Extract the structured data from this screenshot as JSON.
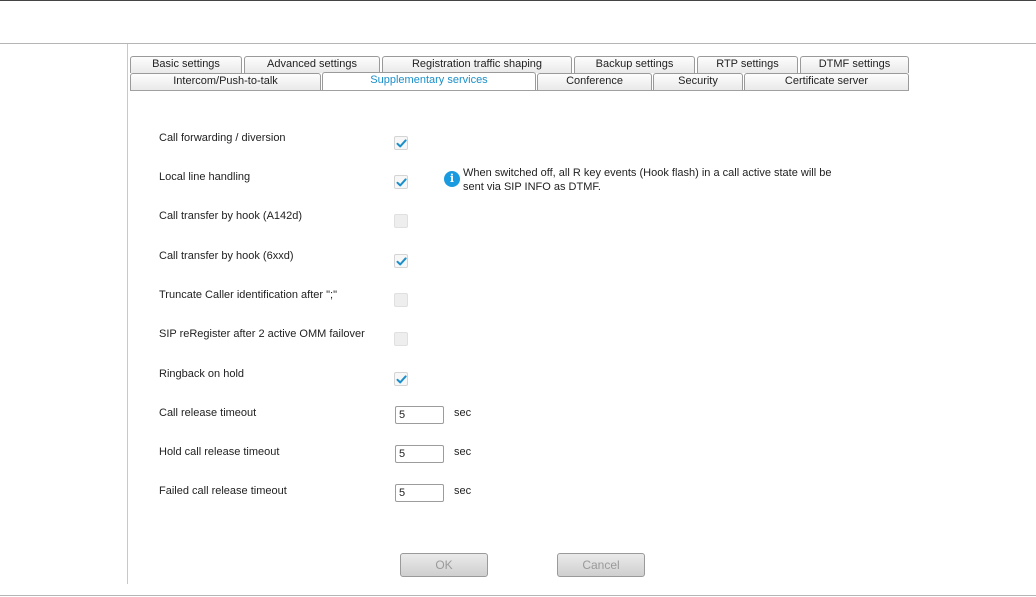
{
  "tabs_row1": [
    "Basic settings",
    "Advanced settings",
    "Registration traffic shaping",
    "Backup settings",
    "RTP settings",
    "DTMF settings"
  ],
  "tabs_row2": [
    "Intercom/Push-to-talk",
    "Supplementary services",
    "Conference",
    "Security",
    "Certificate server"
  ],
  "active_tab": "Supplementary services",
  "accent_color": "#1a8fc9",
  "settings": {
    "call_forwarding": {
      "label": "Call forwarding / diversion",
      "checked": true
    },
    "local_line": {
      "label": "Local line handling",
      "checked": true
    },
    "transfer_a142d": {
      "label": "Call transfer by hook (A142d)",
      "checked": false,
      "disabled": true
    },
    "transfer_6xxd": {
      "label": "Call transfer by hook (6xxd)",
      "checked": true
    },
    "truncate_caller": {
      "label": "Truncate Caller identification after \";\"",
      "checked": false,
      "disabled": true
    },
    "sip_reregister": {
      "label": "SIP reRegister after 2 active OMM failover",
      "checked": false,
      "disabled": true
    },
    "ringback": {
      "label": "Ringback on hold",
      "checked": true
    }
  },
  "info_text": "When switched off, all R key events (Hook flash) in a call active state will be sent via SIP INFO as DTMF.",
  "timeouts": {
    "call_release": {
      "label": "Call release timeout",
      "value": "5",
      "unit": "sec"
    },
    "hold_call_release": {
      "label": "Hold call release timeout",
      "value": "5",
      "unit": "sec"
    },
    "failed_call_release": {
      "label": "Failed call release timeout",
      "value": "5",
      "unit": "sec"
    }
  },
  "buttons": {
    "ok": "OK",
    "cancel": "Cancel"
  }
}
